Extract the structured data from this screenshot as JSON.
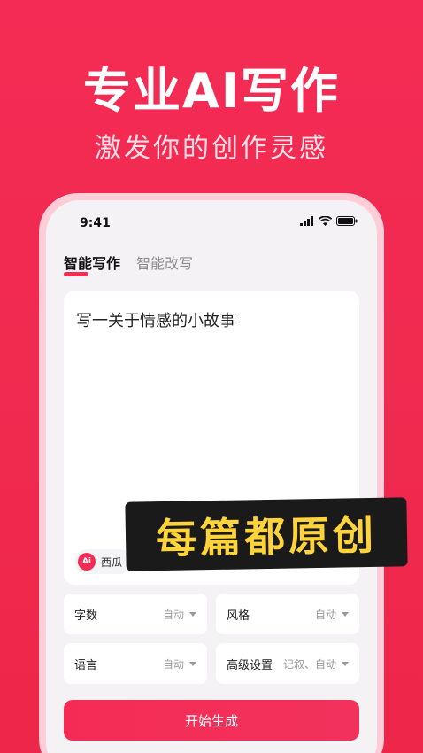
{
  "hero": {
    "title": "专业AI写作",
    "subtitle": "激发你的创作灵感"
  },
  "status_bar": {
    "time": "9:41",
    "icons": [
      "signal-icon",
      "wifi-icon",
      "battery-icon"
    ]
  },
  "tabs": [
    {
      "label": "智能写作",
      "active": true
    },
    {
      "label": "智能改写",
      "active": false
    }
  ],
  "editor": {
    "prompt": "写一关于情感的小故事",
    "model": {
      "logo": "Ai",
      "name": "西瓜"
    }
  },
  "banner": {
    "text": "每篇都原创"
  },
  "options": [
    {
      "label": "字数",
      "value": "自动"
    },
    {
      "label": "风格",
      "value": "自动"
    },
    {
      "label": "语言",
      "value": "自动"
    },
    {
      "label": "高级设置",
      "value": "记叙、自动"
    }
  ],
  "generate_button": {
    "label": "开始生成"
  },
  "colors": {
    "accent": "#f42c55",
    "banner_bg": "#1a1a1a",
    "banner_text": "#ffd43b"
  }
}
